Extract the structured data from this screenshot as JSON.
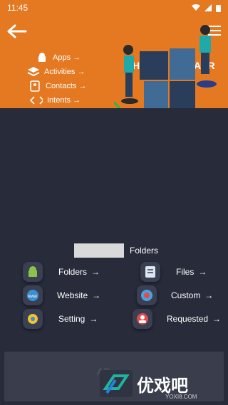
{
  "status": {
    "time": "11:45"
  },
  "header": {
    "shortcuts": [
      {
        "label": "Apps →",
        "icon": "android-icon"
      },
      {
        "label": "Activities →",
        "icon": "layers-icon"
      },
      {
        "label": "Contacts →",
        "icon": "contact-icon"
      },
      {
        "label": "Intents →",
        "icon": "code-icon"
      }
    ],
    "brand_left": "H",
    "brand_right": "AER"
  },
  "section": {
    "title": "Folders"
  },
  "grid": [
    {
      "label": "Folders",
      "icon": "android-icon",
      "arrow": "→"
    },
    {
      "label": "Files",
      "icon": "document-icon",
      "arrow": "→"
    },
    {
      "label": "Website",
      "icon": "globe-icon",
      "arrow": "→"
    },
    {
      "label": "Custom",
      "icon": "target-icon",
      "arrow": "→"
    },
    {
      "label": "Setting",
      "icon": "gear-icon",
      "arrow": "→"
    },
    {
      "label": "Requested",
      "icon": "user-group-icon",
      "arrow": "→"
    }
  ],
  "bottom": {
    "text": "AD"
  },
  "watermark": {
    "text": "优戏吧",
    "sub": "YOXI8.COM"
  },
  "colors": {
    "header": "#e57921",
    "background": "#272b3a"
  }
}
